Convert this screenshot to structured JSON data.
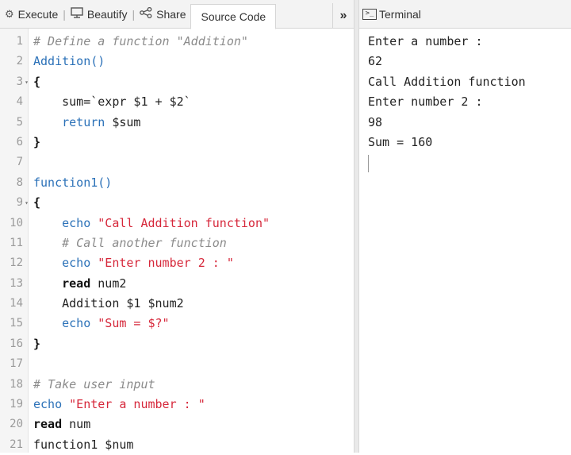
{
  "toolbar": {
    "execute_label": "Execute",
    "beautify_label": "Beautify",
    "share_label": "Share",
    "source_tab_label": "Source Code",
    "separator": "|",
    "more_label": "»"
  },
  "editor": {
    "line_numbers": [
      "1",
      "2",
      "3",
      "4",
      "5",
      "6",
      "7",
      "8",
      "9",
      "10",
      "11",
      "12",
      "13",
      "14",
      "15",
      "16",
      "17",
      "18",
      "19",
      "20",
      "21"
    ],
    "lines": {
      "l1": "# Define a function \"Addition\"",
      "l2": "Addition()",
      "l3": "{",
      "l4_indent": "    ",
      "l4": "sum=`expr $1 + $2`",
      "l5_kw": "return",
      "l5_rest": " $sum",
      "l6": "}",
      "l8": "function1()",
      "l9": "{",
      "l10_kw": "echo",
      "l10_str": "\"Call Addition function\"",
      "l11": "# Call another function",
      "l12_kw": "echo",
      "l12_str": "\"Enter number 2 : \"",
      "l13_kw": "read",
      "l13_rest": " num2",
      "l14": "Addition $1 $num2",
      "l15_kw": "echo",
      "l15_str": "\"Sum = $?\"",
      "l16": "}",
      "l18": "# Take user input",
      "l19_kw": "echo",
      "l19_str": "\"Enter a number : \"",
      "l20_kw": "read",
      "l20_rest": " num",
      "l21": "function1 $num"
    }
  },
  "terminal": {
    "title": "Terminal",
    "icon_glyph": ">_",
    "lines": [
      "Enter a number :",
      "62",
      "Call Addition function",
      "Enter number 2 :",
      "98",
      "Sum = 160"
    ]
  }
}
